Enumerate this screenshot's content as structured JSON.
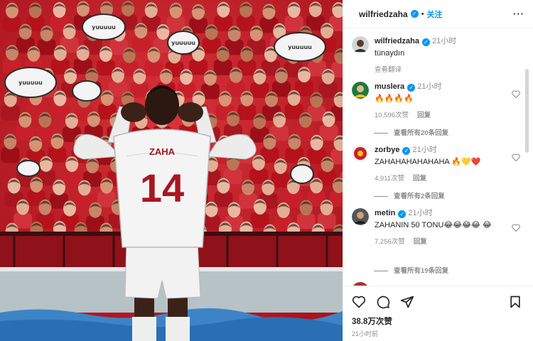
{
  "post": {
    "author": "wilfriedzaha",
    "follow_label": "关注",
    "more_label": "···",
    "jersey_name": "ZAHA",
    "jersey_number": "14",
    "speech_text": "yuuuuu"
  },
  "caption": {
    "username": "wilfriedzaha",
    "time": "21小时",
    "text": "tünaydın",
    "translate_label": "查看翻译"
  },
  "comments": [
    {
      "username": "muslera",
      "time": "21小时",
      "text": "🔥🔥🔥🔥",
      "likes": "10,596次赞",
      "reply_label": "回复",
      "view_replies": "查看所有20条回复"
    },
    {
      "username": "zorbye",
      "time": "21小时",
      "text": "ZAHAHAHAHAHAHA 🔥💛❤️",
      "likes": "4,911次赞",
      "reply_label": "回复",
      "view_replies": "查看所有2条回复"
    },
    {
      "username": "metin",
      "time": "21小时",
      "text": "ZAHANIN 50 TONU😂😂😂😂 😂",
      "likes": "7,256次赞",
      "reply_label": "回复",
      "view_replies": "查看所有19条回复"
    }
  ],
  "footer": {
    "likes": "38.8万次赞",
    "time_ago": "21小时前"
  },
  "icons": [
    "more-icon",
    "verified-badge-icon",
    "heart-icon",
    "comment-icon",
    "share-icon",
    "bookmark-icon"
  ],
  "colors": {
    "accent": "#0095f6",
    "stadium_red": "#c8202a",
    "text": "#262626",
    "muted": "#8e8e8e"
  }
}
